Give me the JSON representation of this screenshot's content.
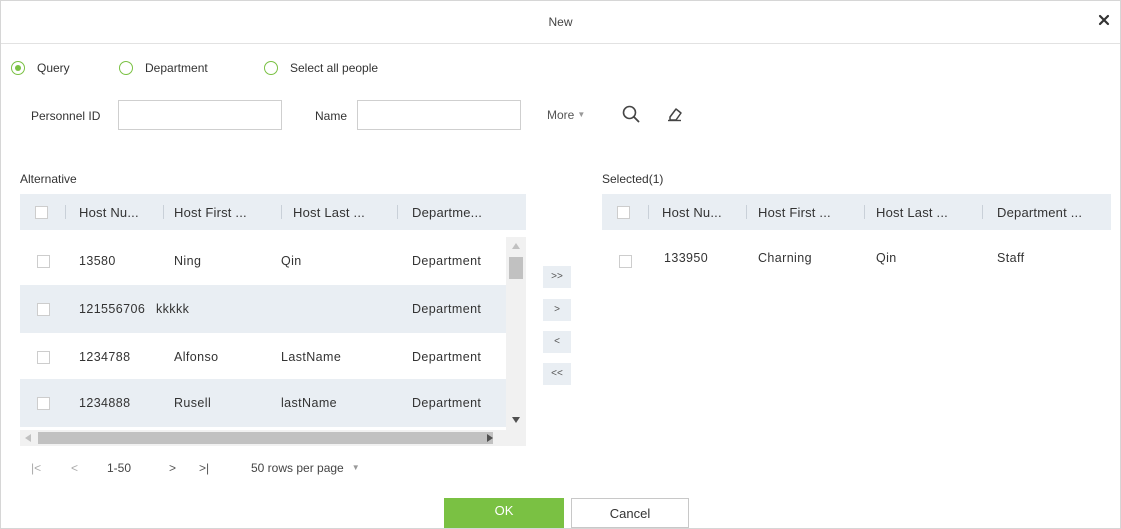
{
  "dialog": {
    "title": "New"
  },
  "radios": [
    {
      "label": "Query",
      "checked": true
    },
    {
      "label": "Department",
      "checked": false
    },
    {
      "label": "Select all people",
      "checked": false
    }
  ],
  "filters": {
    "personnel_id_label": "Personnel ID",
    "personnel_id_value": "",
    "name_label": "Name",
    "name_value": "",
    "more_label": "More"
  },
  "alternative": {
    "label": "Alternative",
    "columns": [
      "Host Nu...",
      "Host First ...",
      "Host Last ...",
      "Departme..."
    ],
    "rows": [
      [
        "13580",
        "Ning",
        "Qin",
        "Department"
      ],
      [
        "121556706",
        "kkkkk",
        "",
        "Department"
      ],
      [
        "1234788",
        "Alfonso",
        "LastName",
        "Department"
      ],
      [
        "1234888",
        "Rusell",
        "lastName",
        "Department"
      ]
    ]
  },
  "transfer": {
    "add_all": ">>",
    "add": ">",
    "remove": "<",
    "remove_all": "<<"
  },
  "selected": {
    "label": "Selected(1)",
    "columns": [
      "Host Nu...",
      "Host First ...",
      "Host Last ...",
      "Department ..."
    ],
    "rows": [
      [
        "133950",
        "Charning",
        "Qin",
        "Staff"
      ]
    ]
  },
  "pagination": {
    "first": "|<",
    "prev": "<",
    "range": "1-50",
    "next": ">",
    "last": ">|",
    "rows_per_page": "50 rows per page"
  },
  "footer": {
    "ok_label": "OK",
    "cancel_label": "Cancel"
  },
  "colors": {
    "accent": "#7ac143",
    "header_bg": "#e9eef3"
  }
}
